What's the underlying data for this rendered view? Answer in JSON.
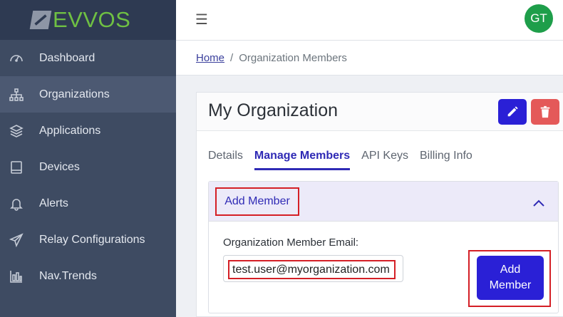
{
  "app": {
    "logo_text": "EVVOS"
  },
  "sidebar": {
    "items": [
      {
        "label": "Dashboard",
        "icon": "gauge-icon",
        "active": false
      },
      {
        "label": "Organizations",
        "icon": "sitemap-icon",
        "active": true
      },
      {
        "label": "Applications",
        "icon": "layers-icon",
        "active": false
      },
      {
        "label": "Devices",
        "icon": "tablet-icon",
        "active": false
      },
      {
        "label": "Alerts",
        "icon": "bell-icon",
        "active": false
      },
      {
        "label": "Relay Configurations",
        "icon": "paper-plane-icon",
        "active": false
      },
      {
        "label": "Nav.Trends",
        "icon": "bar-chart-icon",
        "active": false
      }
    ]
  },
  "topbar": {
    "menu_glyph": "☰",
    "avatar_initials": "GT"
  },
  "breadcrumb": {
    "home": "Home",
    "separator": "/",
    "current": "Organization Members"
  },
  "card": {
    "title": "My Organization",
    "tabs": [
      {
        "label": "Details",
        "active": false
      },
      {
        "label": "Manage Members",
        "active": true
      },
      {
        "label": "API Keys",
        "active": false
      },
      {
        "label": "Billing Info",
        "active": false
      }
    ]
  },
  "add_member": {
    "header": "Add Member",
    "email_label": "Organization Member Email:",
    "email_value": "test.user@myorganization.com",
    "button_line1": "Add",
    "button_line2": "Member"
  },
  "colors": {
    "primary": "#2a20d6",
    "danger": "#e45959",
    "highlight": "#d41f26",
    "sidebar": "#3e4b62",
    "logo_green": "#6fc043",
    "avatar": "#1e9e4a"
  }
}
